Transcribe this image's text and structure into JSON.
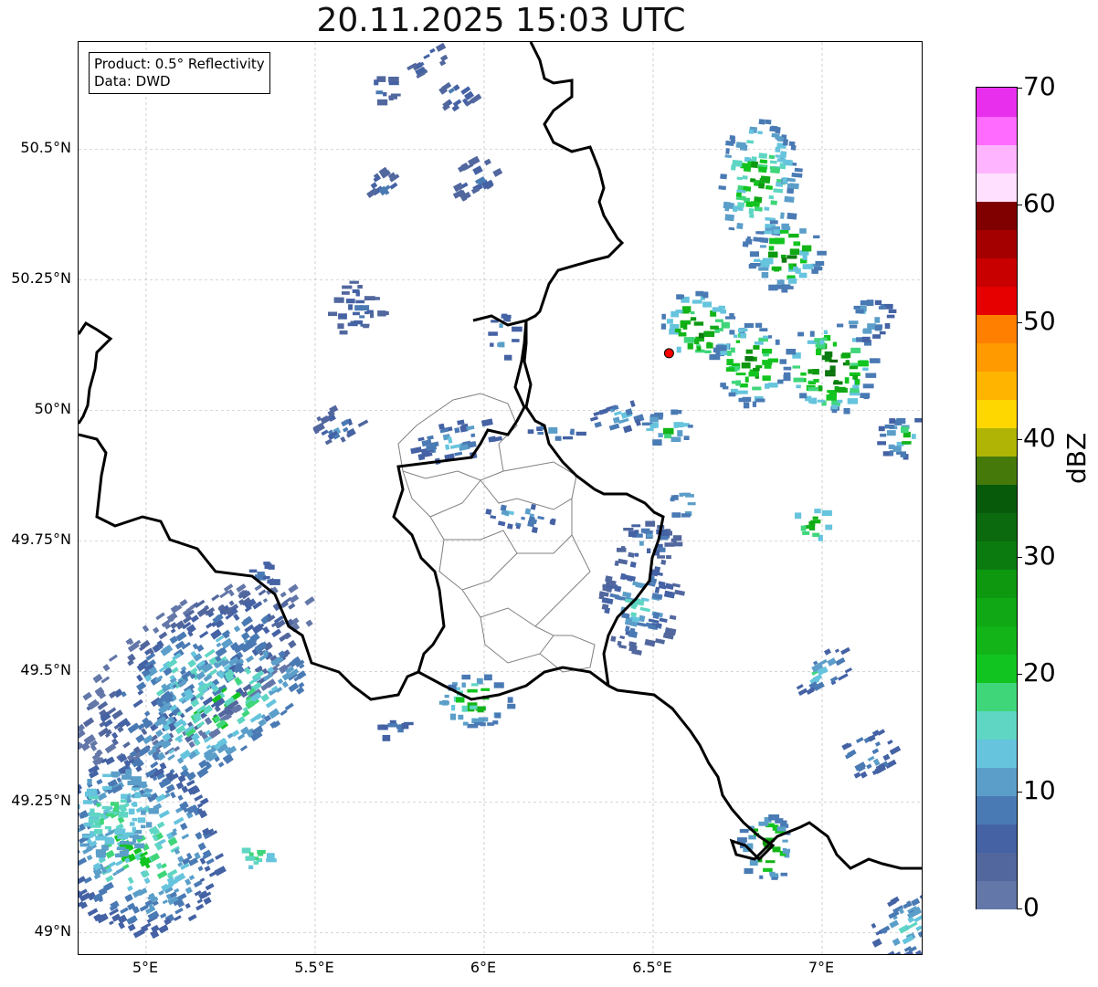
{
  "title": "20.11.2025 15:03 UTC",
  "info": {
    "product": "Product: 0.5° Reflectivity",
    "data": "Data: DWD"
  },
  "map": {
    "lon_range": [
      4.8,
      7.3
    ],
    "lat_range": [
      48.955,
      50.705
    ],
    "lat_ticks": [
      "50.5°N",
      "50.25°N",
      "50°N",
      "49.75°N",
      "49.5°N",
      "49.25°N",
      "49°N"
    ],
    "lat_tick_values": [
      50.5,
      50.25,
      50.0,
      49.75,
      49.5,
      49.25,
      49.0
    ],
    "lon_ticks": [
      "5°E",
      "5.5°E",
      "6°E",
      "6.5°E",
      "7°E"
    ],
    "lon_tick_values": [
      5.0,
      5.5,
      6.0,
      6.5,
      7.0
    ],
    "grid": true,
    "radar_site": {
      "lon": 6.547,
      "lat": 50.109,
      "color": "#ff0000"
    }
  },
  "colorbar": {
    "label": "dBZ",
    "min": 0,
    "max": 70,
    "tick_labels": [
      "70",
      "60",
      "50",
      "40",
      "30",
      "20",
      "10",
      "0"
    ],
    "tick_values": [
      70,
      60,
      50,
      40,
      30,
      20,
      10,
      0
    ],
    "colors": [
      "#6377a8",
      "#51679e",
      "#4462a4",
      "#4a7ab4",
      "#5b9ec9",
      "#66c4dd",
      "#5fd6c3",
      "#3fd67a",
      "#12c41f",
      "#12b418",
      "#10a814",
      "#0e9810",
      "#0b7b10",
      "#0a6a0d",
      "#085a0b",
      "#457a0a",
      "#b0b404",
      "#ffd700",
      "#ffb400",
      "#ff9a00",
      "#ff7f00",
      "#e60000",
      "#c80000",
      "#a40000",
      "#800000",
      "#ffe1ff",
      "#ffb4ff",
      "#ff6aff",
      "#e92fee"
    ]
  }
}
